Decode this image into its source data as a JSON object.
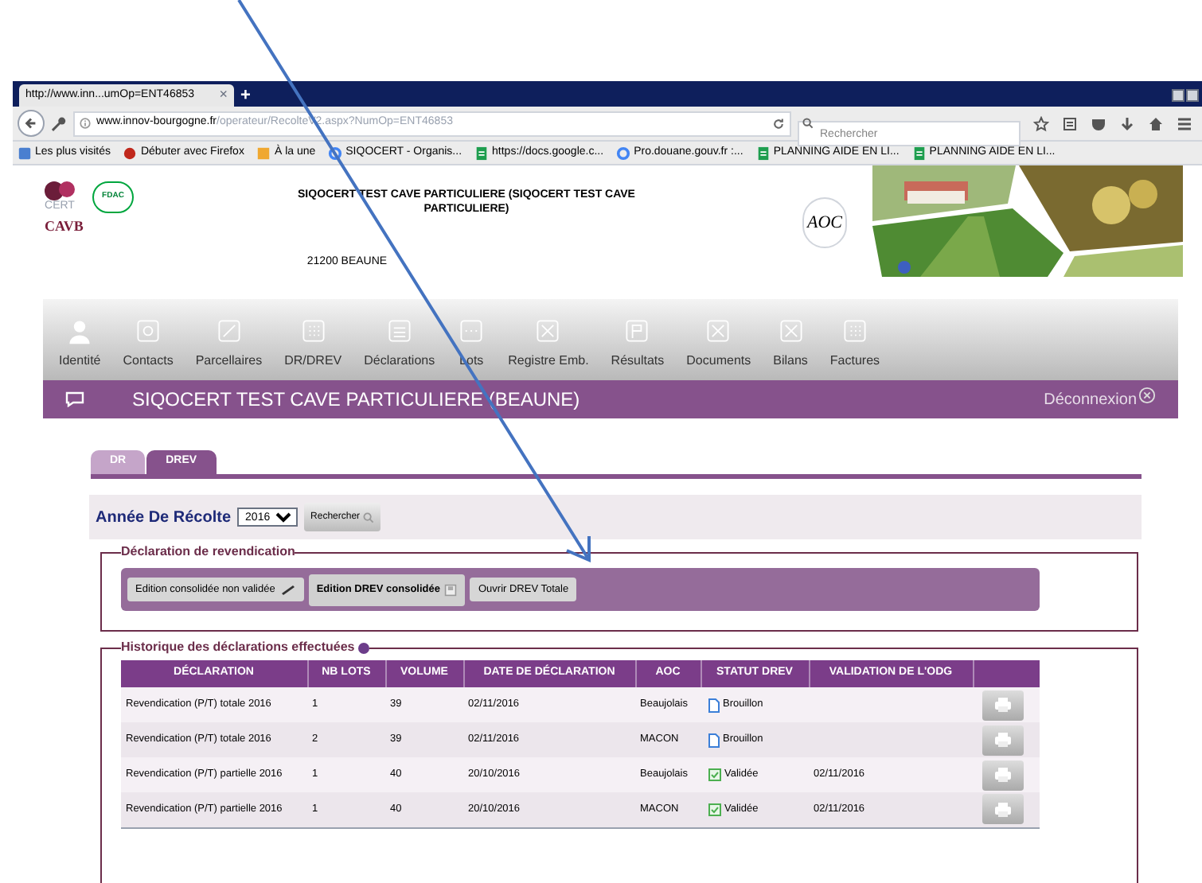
{
  "browser": {
    "tab_title": "http://www.inn...umOp=ENT46853",
    "tab_close": "×",
    "new_tab": "+",
    "url_host": "www.innov-bourgogne.fr",
    "url_path": "/operateur/RecolteV2.aspx?NumOp=ENT46853",
    "search_placeholder": "Rechercher",
    "bookmarks": [
      {
        "label": "Les plus visités",
        "kind": "star"
      },
      {
        "label": "Débuter avec Firefox",
        "kind": "fox"
      },
      {
        "label": "À la une",
        "kind": "feed"
      },
      {
        "label": "SIQOCERT - Organis...",
        "kind": "g"
      },
      {
        "label": "https://docs.google.c...",
        "kind": "sheet"
      },
      {
        "label": "Pro.douane.gouv.fr :...",
        "kind": "g"
      },
      {
        "label": "PLANNING AIDE EN LI...",
        "kind": "sheet"
      },
      {
        "label": "PLANNING AIDE EN LI...",
        "kind": "sheet"
      }
    ]
  },
  "header": {
    "logos": [
      "CERT",
      "FDAC",
      "CAVB"
    ],
    "title": "SIQOCERT TEST CAVE PARTICULIERE (SIQOCERT TEST CAVE PARTICULIERE)",
    "address": "21200 BEAUNE",
    "aoc_logo": "AOC"
  },
  "nav": [
    {
      "label": "Identité",
      "kind": "person"
    },
    {
      "label": "Contacts",
      "kind": "at"
    },
    {
      "label": "Parcellaires",
      "kind": "line"
    },
    {
      "label": "DR/DREV",
      "kind": "grid"
    },
    {
      "label": "Déclarations",
      "kind": "list"
    },
    {
      "label": "Lots",
      "kind": "dots"
    },
    {
      "label": "Registre Emb.",
      "kind": "cross"
    },
    {
      "label": "Résultats",
      "kind": "flag"
    },
    {
      "label": "Documents",
      "kind": "cross"
    },
    {
      "label": "Bilans",
      "kind": "cross"
    },
    {
      "label": "Factures",
      "kind": "grid"
    }
  ],
  "member_bar": {
    "title": "SIQOCERT TEST CAVE PARTICULIERE (BEAUNE)",
    "logout": "Déconnexion"
  },
  "tabs": [
    {
      "label": "DR",
      "selected": false
    },
    {
      "label": "DREV",
      "selected": true
    }
  ],
  "filter": {
    "label": "Année De Récolte",
    "year": "2016",
    "button": "Rechercher"
  },
  "revendication": {
    "legend": "Déclaration de revendication",
    "buttons": [
      {
        "label": "Edition consolidée non validée",
        "kind": "edit",
        "bold": false
      },
      {
        "label": "Edition DREV consolidée",
        "kind": "save",
        "bold": true
      },
      {
        "label": "Ouvrir DREV Totale",
        "kind": "plain",
        "bold": false
      }
    ]
  },
  "history": {
    "legend": "Historique des déclarations effectuées",
    "columns": [
      "DÉCLARATION",
      "NB LOTS",
      "VOLUME",
      "DATE DE DÉCLARATION",
      "AOC",
      "STATUT DREV",
      "VALIDATION DE L'ODG"
    ],
    "rows": [
      {
        "declaration": "Revendication (P/T) totale 2016",
        "lots": "1",
        "volume": "39",
        "date": "02/11/2016",
        "aoc": "Beaujolais",
        "status": "Brouillon",
        "validated": false
      },
      {
        "declaration": "Revendication (P/T) totale 2016",
        "lots": "2",
        "volume": "39",
        "date": "02/11/2016",
        "aoc": "MACON",
        "status": "Brouillon",
        "validated": false
      },
      {
        "declaration": "Revendication (P/T) partielle 2016",
        "lots": "1",
        "volume": "40",
        "date": "20/10/2016",
        "aoc": "Beaujolais",
        "status": "Validée",
        "validated": true,
        "validation": "02/11/2016"
      },
      {
        "declaration": "Revendication (P/T) partielle 2016",
        "lots": "1",
        "volume": "40",
        "date": "20/10/2016",
        "aoc": "MACON",
        "status": "Validée",
        "validated": true,
        "validation": "02/11/2016"
      }
    ]
  }
}
